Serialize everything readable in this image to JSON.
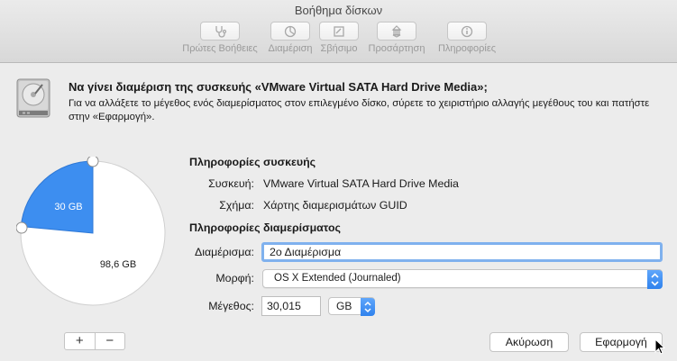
{
  "window": {
    "title": "Βοήθημα δίσκων"
  },
  "toolbar": {
    "items": [
      {
        "label": "Πρώτες Βοήθειες",
        "icon": "stethoscope-icon"
      },
      {
        "label": "Διαμέριση",
        "icon": "partition-icon"
      },
      {
        "label": "Σβήσιμο",
        "icon": "erase-icon"
      },
      {
        "label": "Προσάρτηση",
        "icon": "mount-icon"
      },
      {
        "label": "Πληροφορίες",
        "icon": "info-icon"
      }
    ]
  },
  "sheet": {
    "heading": "Να γίνει διαμέριση της συσκευής «VMware Virtual SATA Hard Drive Media»;",
    "description": "Για να αλλάξετε το μέγεθος ενός διαμερίσματος στον επιλεγμένο δίσκο, σύρετε το χειριστήριο αλλαγής μεγέθους του και πατήστε στην «Εφαρμογή».",
    "pie": {
      "selected_label": "30 GB",
      "other_label": "98,6 GB",
      "selected_fraction": 0.234,
      "accent": "#3d8ef0"
    },
    "device_section": {
      "title": "Πληροφορίες συσκευής",
      "device_label": "Συσκευή:",
      "device_value": "VMware Virtual SATA Hard Drive Media",
      "scheme_label": "Σχήμα:",
      "scheme_value": "Χάρτης διαμερισμάτων GUID"
    },
    "partition_section": {
      "title": "Πληροφορίες διαμερίσματος",
      "name_label": "Διαμέρισμα:",
      "name_value": "2ο Διαμέρισμα",
      "format_label": "Μορφή:",
      "format_value": "OS X Extended (Journaled)",
      "size_label": "Μέγεθος:",
      "size_value": "30,015",
      "unit_value": "GB"
    },
    "buttons": {
      "add": "+",
      "remove": "−",
      "cancel": "Ακύρωση",
      "apply": "Εφαρμογή"
    }
  }
}
